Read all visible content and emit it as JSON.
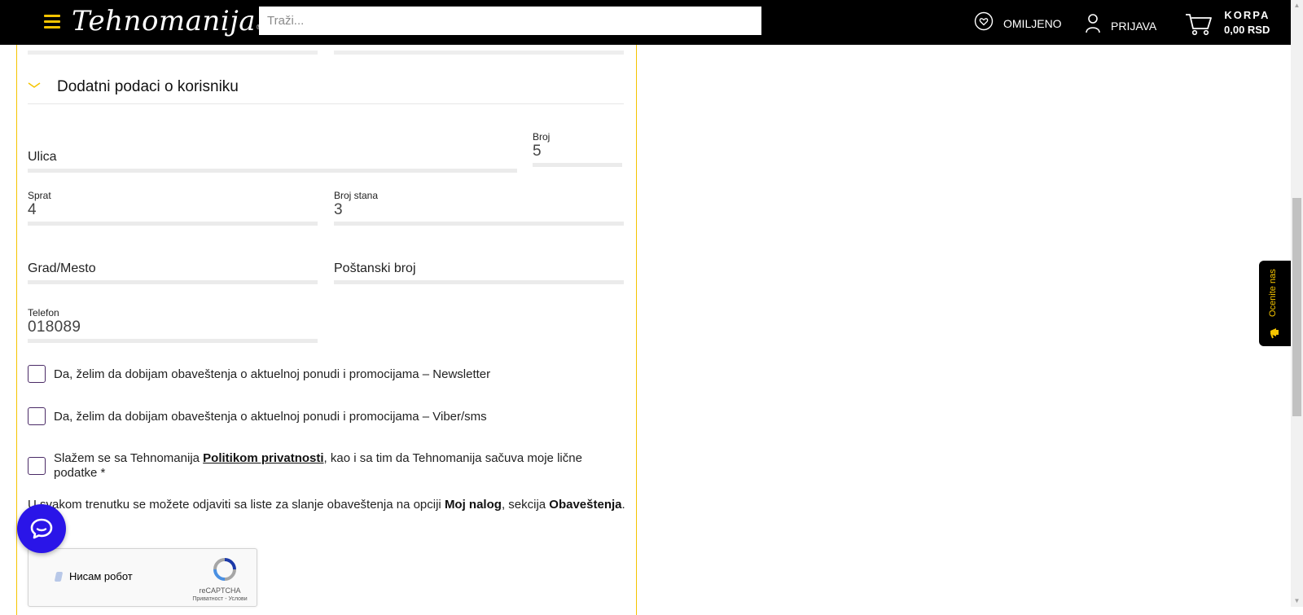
{
  "header": {
    "logo_text": "Tehnomanija",
    "search_placeholder": "Traži...",
    "favorites_label": "OMILJENO",
    "login_label": "PRIJAVA",
    "cart_label": "KORPA",
    "cart_total": "0,00 RSD"
  },
  "section": {
    "title": "Dodatni podaci o korisniku"
  },
  "form": {
    "ulica": {
      "placeholder": "Ulica"
    },
    "broj": {
      "label": "Broj",
      "value": "5"
    },
    "sprat": {
      "label": "Sprat",
      "value": "4"
    },
    "broj_stana": {
      "label": "Broj stana",
      "value": "3"
    },
    "grad": {
      "placeholder": "Grad/Mesto"
    },
    "postanski_broj": {
      "placeholder": "Poštanski broj"
    },
    "telefon": {
      "label": "Telefon",
      "value": "018089"
    }
  },
  "checkboxes": {
    "newsletter": "Da, želim da dobijam obaveštenja o aktuelnoj ponudi i promocijama – Newsletter",
    "viber": "Da, želim da dobijam obaveštenja o aktuelnoj ponudi i promocijama – Viber/sms",
    "consent_prefix": "Slažem se sa Tehnomanija ",
    "consent_link": "Politikom privatnosti",
    "consent_suffix": ", kao i sa tim da Tehnomanija sačuva moje lične podatke *"
  },
  "note": {
    "prefix": "U svakom trenutku se možete odjaviti sa liste za slanje obaveštenja na opciji ",
    "bold1": "Moj nalog",
    "middle": ", sekcija ",
    "bold2": "Obaveštenja",
    "suffix": "."
  },
  "captcha": {
    "label": "Нисам робот",
    "brand": "reCAPTCHA",
    "terms": "Приватност - Услови"
  },
  "rate_tab": {
    "label": "Ocenite nas"
  },
  "colors": {
    "accent": "#f5c400",
    "header_bg": "#000000",
    "chat_bg": "#2a15e8",
    "checkbox_border": "#4a2a66"
  },
  "icons": {
    "menu": "hamburger-icon",
    "favorites": "heart-icon",
    "login": "user-icon",
    "cart": "cart-icon",
    "section_toggle": "chevron-down-icon",
    "chat": "chat-icon",
    "rate": "megaphone-icon"
  }
}
